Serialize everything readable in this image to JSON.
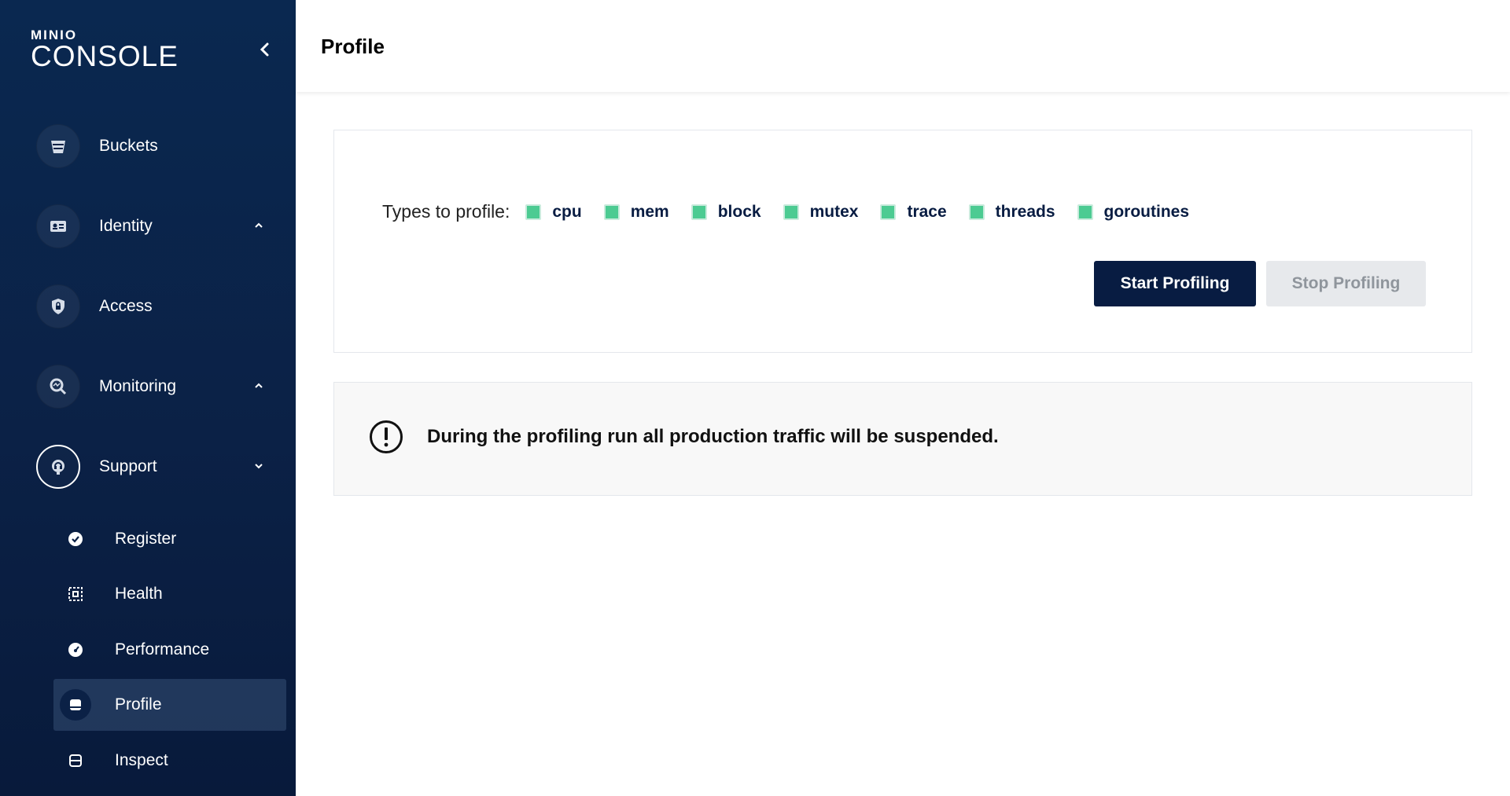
{
  "sidebar": {
    "logo": {
      "small": "MINIO",
      "big": "CONSOLE"
    },
    "items": [
      {
        "label": "Buckets"
      },
      {
        "label": "Identity"
      },
      {
        "label": "Access"
      },
      {
        "label": "Monitoring"
      },
      {
        "label": "Support"
      }
    ],
    "support_items": [
      {
        "label": "Register"
      },
      {
        "label": "Health"
      },
      {
        "label": "Performance"
      },
      {
        "label": "Profile"
      },
      {
        "label": "Inspect"
      }
    ]
  },
  "header": {
    "title": "Profile"
  },
  "profile": {
    "types_label": "Types to profile:",
    "types": [
      {
        "label": "cpu",
        "checked": true
      },
      {
        "label": "mem",
        "checked": true
      },
      {
        "label": "block",
        "checked": true
      },
      {
        "label": "mutex",
        "checked": true
      },
      {
        "label": "trace",
        "checked": true
      },
      {
        "label": "threads",
        "checked": true
      },
      {
        "label": "goroutines",
        "checked": true
      }
    ],
    "start_label": "Start Profiling",
    "stop_label": "Stop Profiling"
  },
  "warning": {
    "text": "During the profiling run all production traffic will be suspended."
  },
  "colors": {
    "sidebar": "#0b2146",
    "primary": "#081c42",
    "checkbox": "#4ccb92",
    "disabled": "#e7e9ec"
  }
}
